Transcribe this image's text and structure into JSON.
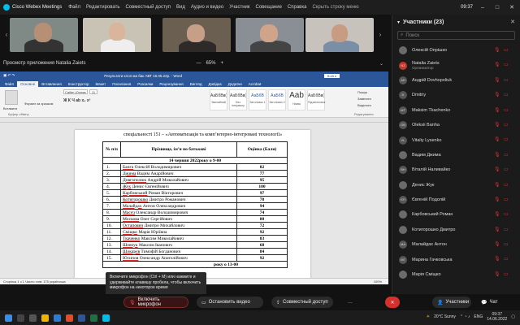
{
  "topbar": {
    "app_title": "Cisco Webex Meetings",
    "menu": [
      "Файл",
      "Редактировать",
      "Совместный доступ",
      "Вид",
      "Аудио и видео",
      "Участник",
      "Совещание",
      "Справка"
    ],
    "hide_menu": "Скрыть строку меню",
    "clock": "09:37"
  },
  "share_header": {
    "viewing": "Просмотр приложения Natalia Zaiets",
    "zoom": "65%",
    "zoom_minus": "—",
    "zoom_plus": "+",
    "options": "⌄"
  },
  "word": {
    "title_left": "Файл   Главная",
    "doc_title": "Результати клоп ма бак АВТ 16.05.22р. - Word",
    "sign_in": "Войти",
    "tabs": [
      "Файл",
      "Основное",
      "Вставлення",
      "Конструктор",
      "Макет",
      "Посилання",
      "Розсилки",
      "Рецензування",
      "Вигляд",
      "Довідка",
      "Додатки",
      "Acrobat",
      "Макет"
    ],
    "active_tab": "Основне",
    "font_name": "Calibri (Основ",
    "font_size": "11",
    "styles": [
      {
        "sample": "АаБбВв(",
        "name": "Звичайний"
      },
      {
        "sample": "АаБбВв(",
        "name": "Без інтервалу"
      },
      {
        "sample": "АаБбВ",
        "name": "Заголовок 1"
      },
      {
        "sample": "АаБбВ",
        "name": "Заголовок 2"
      },
      {
        "sample": "Aab",
        "name": "Назва"
      },
      {
        "sample": "АаБбВв(",
        "name": "Підзаголовок"
      }
    ],
    "paste": "Вставити",
    "clipboard": "Буфер обміну",
    "format_painter": "Формат за зразком",
    "find": "Пошук",
    "replace": "Замінити",
    "select": "Виділити",
    "edit_group": "Редагування",
    "status_left": "Сторінка 1 з 1   Число слів: 175   українська",
    "status_right": "100%"
  },
  "document": {
    "subtitle": "спеціальності 151 – «Автоматизація та комп’ютерно-інтегровані технології»",
    "col_num": "№ п/п",
    "col_name": "Прізвище, ім’я по батькові",
    "col_score": "Оцінка (Бали)",
    "section1": "14 червня 2022року о 9-00",
    "rows": [
      {
        "num": "1.",
        "surname": "Банга",
        "rest": "Олексій Володимирович",
        "score": "82"
      },
      {
        "num": "2.",
        "surname": "Джима",
        "rest": "Вадим Андрійович",
        "score": "77"
      },
      {
        "num": "3.",
        "surname": "Довгополюк",
        "rest": "Андрій Миколайович",
        "score": "95"
      },
      {
        "num": "4.",
        "surname": "Жук",
        "rest": "Денис Євгенійович",
        "score": "100"
      },
      {
        "num": "5.",
        "surname": "Карбовський",
        "rest": "Роман Вікторович",
        "score": "97"
      },
      {
        "num": "6.",
        "surname": "Котигорошко",
        "rest": "Дмитро Романович",
        "score": "78"
      },
      {
        "num": "7.",
        "surname": "Малайдах",
        "rest": "Антон Олександрович",
        "score": "94"
      },
      {
        "num": "8.",
        "surname": "Масєч",
        "rest": "Олександр Володимирович",
        "score": "74"
      },
      {
        "num": "9.",
        "surname": "Москова",
        "rest": "Олег Сергійович",
        "score": "80"
      },
      {
        "num": "10.",
        "surname": "Остапович",
        "rest": "Дмитро Михайлович",
        "score": "72"
      },
      {
        "num": "11.",
        "surname": "Сміщко",
        "rest": "Марія Юріївна",
        "score": "92"
      },
      {
        "num": "12.",
        "surname": "Ткаченко",
        "rest": "Максим Миколайович",
        "score": "83"
      },
      {
        "num": "13.",
        "surname": "Шевчук",
        "rest": "Максим Іванович",
        "score": "68"
      },
      {
        "num": "14.",
        "surname": "Шокарєв",
        "rest": "Тимофій Богданович",
        "score": "84"
      },
      {
        "num": "15.",
        "surname": "Юсипов",
        "rest": "Олександр Анатолійович",
        "score": "92"
      }
    ],
    "section2": "року о 13-00"
  },
  "tooltip": "Включите микрофон (Ctrl + M) или нажмите и удерживайте клавишу пробела, чтобы включить микрофон на некоторое время",
  "controls": {
    "mute": "Включить микрофон",
    "video": "Остановить видео",
    "share": "Совместный доступ",
    "more": "…",
    "participants": "Участники",
    "chat": "Чат"
  },
  "panel": {
    "title": "Участники (23)",
    "search_placeholder": "Поиск",
    "participants": [
      {
        "name": "Олексій Опрішко",
        "initials": "",
        "role": ""
      },
      {
        "name": "Natalia Zaiets",
        "initials": "NZ",
        "role": "Организатор"
      },
      {
        "name": "Андрій Dovhopoliuk",
        "initials": "AD",
        "role": ""
      },
      {
        "name": "Dmitriy",
        "initials": "D",
        "role": ""
      },
      {
        "name": "Maksim Tkachenko",
        "initials": "MT",
        "role": ""
      },
      {
        "name": "Oleksii Banha",
        "initials": "OB",
        "role": ""
      },
      {
        "name": "Vitaliy Lysenko",
        "initials": "VL",
        "role": ""
      },
      {
        "name": "Вадим Джима",
        "initials": "",
        "role": ""
      },
      {
        "name": "Віталій Наливайко",
        "initials": "ВН",
        "role": ""
      },
      {
        "name": "Денис Жук",
        "initials": "",
        "role": ""
      },
      {
        "name": "Євгеній Подолій",
        "initials": "ЄП",
        "role": ""
      },
      {
        "name": "Карбовський Роман",
        "initials": "",
        "role": ""
      },
      {
        "name": "Котигорошко Дмитро",
        "initials": "",
        "role": ""
      },
      {
        "name": "Малайдах Антон",
        "initials": "МА",
        "role": ""
      },
      {
        "name": "Марина Гачковська",
        "initials": "МГ",
        "role": ""
      },
      {
        "name": "Марія Сміщко",
        "initials": "",
        "role": ""
      }
    ]
  },
  "taskbar": {
    "weather": "20°C  Sunny",
    "lang": "ENG",
    "time": "09:37",
    "date": "14.06.2022"
  },
  "colors": {
    "word_blue": "#2b579a",
    "end_red": "#d6302c",
    "muted_red": "#d33333",
    "cisco_blue": "#00bceb"
  }
}
